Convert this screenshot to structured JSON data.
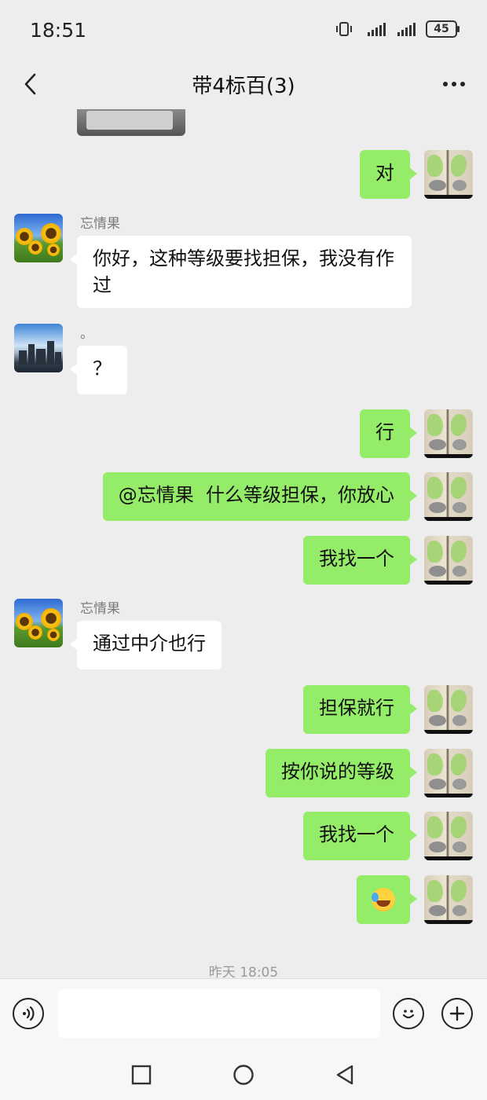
{
  "status": {
    "time": "18:51",
    "battery": "45"
  },
  "header": {
    "title": "带4标百(3)"
  },
  "messages": [
    {
      "side": "out",
      "text": "对"
    },
    {
      "side": "in",
      "sender": "忘情果",
      "text": "你好，这种等级要找担保，我没有作过"
    },
    {
      "side": "in",
      "sender": "。",
      "text": "？"
    },
    {
      "side": "out",
      "text": "行"
    },
    {
      "side": "out",
      "text": "@忘情果  什么等级担保，你放心"
    },
    {
      "side": "out",
      "text": "我找一个"
    },
    {
      "side": "in",
      "sender": "忘情果",
      "text": "通过中介也行"
    },
    {
      "side": "out",
      "text": "担保就行"
    },
    {
      "side": "out",
      "text": "按你说的等级"
    },
    {
      "side": "out",
      "text": "我找一个"
    },
    {
      "side": "out",
      "emoji": "laughing-crying-emoji"
    }
  ],
  "timestamp": "昨天 18:05",
  "input": {
    "value": ""
  },
  "icons": {
    "back": "back-arrow-icon",
    "more": "more-dots-icon",
    "voice": "voice-icon",
    "emoji": "emoji-icon",
    "plus": "plus-icon"
  },
  "colors": {
    "outgoing_bubble": "#95ec69",
    "incoming_bubble": "#ffffff",
    "background": "#ededed"
  }
}
